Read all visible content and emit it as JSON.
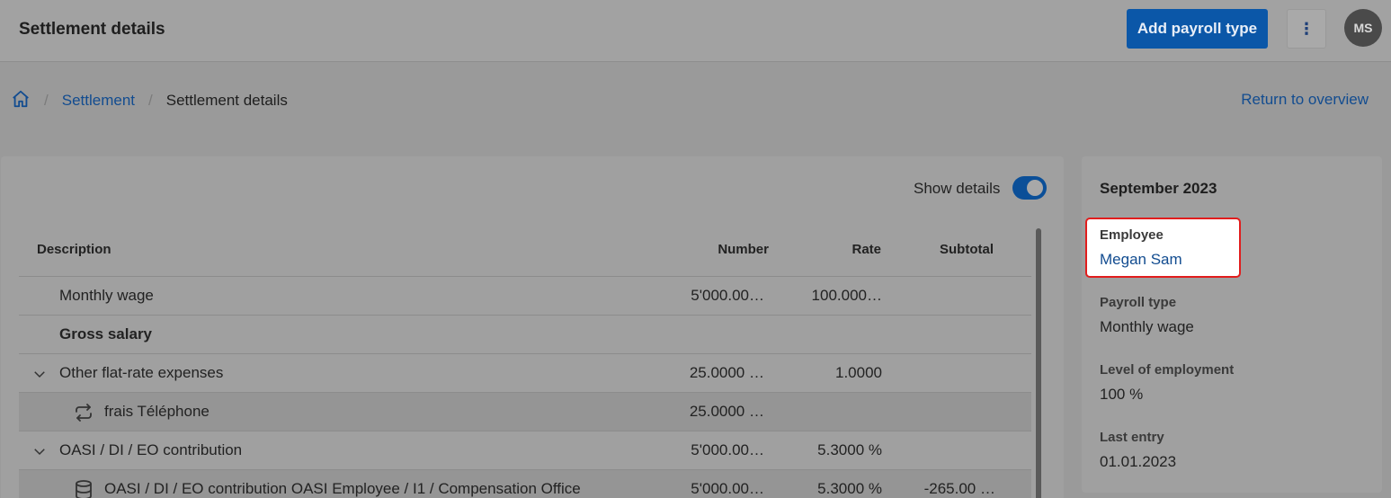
{
  "header": {
    "title": "Settlement details",
    "add_button_label": "Add payroll type",
    "more_icon": "⋮",
    "avatar_initials": "MS"
  },
  "breadcrumb": {
    "items": [
      "Settlement",
      "Settlement details"
    ],
    "separator": "/"
  },
  "return_link": "Return to overview",
  "toolbar": {
    "show_details_label": "Show details",
    "show_details_on": true
  },
  "table": {
    "columns": [
      "Description",
      "Number",
      "Rate",
      "Subtotal"
    ],
    "rows": [
      {
        "description": "Monthly wage",
        "number": "5'000.00…",
        "rate": "100.000…",
        "subtotal": ""
      },
      {
        "description": "Gross salary",
        "number": "",
        "rate": "",
        "subtotal": ""
      },
      {
        "description": "Other flat-rate expenses",
        "number": "25.0000 …",
        "rate": "1.0000",
        "subtotal": ""
      },
      {
        "description": "frais Téléphone",
        "number": "25.0000 …",
        "rate": "",
        "subtotal": ""
      },
      {
        "description": "OASI / DI / EO contribution",
        "number": "5'000.00…",
        "rate": "5.3000 %",
        "subtotal": ""
      },
      {
        "description": "OASI / DI / EO contribution OASI Employee / I1 / Compensation Office",
        "number": "5'000.00…",
        "rate": "5.3000 %",
        "subtotal": "-265.00 …"
      }
    ]
  },
  "side": {
    "month": "September 2023",
    "employee_label": "Employee",
    "employee_value": "Megan Sam",
    "payroll_type_label": "Payroll type",
    "payroll_type_value": "Monthly wage",
    "level_label": "Level of employment",
    "level_value": "100 %",
    "last_entry_label": "Last entry",
    "last_entry_value": "01.01.2023"
  },
  "colors": {
    "accent": "#0b57a8",
    "link": "#124c90",
    "highlight_border": "#e11d1d"
  }
}
